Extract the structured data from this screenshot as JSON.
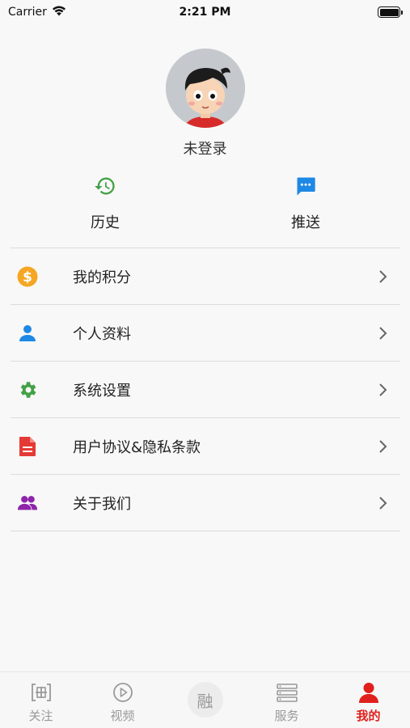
{
  "status_bar": {
    "carrier": "Carrier",
    "time": "2:21 PM"
  },
  "profile": {
    "login_status": "未登录"
  },
  "quick_actions": [
    {
      "label": "历史",
      "icon": "history-icon",
      "color": "#43a047"
    },
    {
      "label": "推送",
      "icon": "chat-bubble-icon",
      "color": "#1e88e5"
    }
  ],
  "menu": [
    {
      "label": "我的积分",
      "icon": "coin-icon",
      "color": "#f5a623"
    },
    {
      "label": "个人资料",
      "icon": "person-icon",
      "color": "#1e88e5"
    },
    {
      "label": "系统设置",
      "icon": "gear-icon",
      "color": "#43a047"
    },
    {
      "label": "用户协议&隐私条款",
      "icon": "document-icon",
      "color": "#e53935"
    },
    {
      "label": "关于我们",
      "icon": "group-icon",
      "color": "#8e24aa"
    }
  ],
  "tabbar": {
    "active_color": "#e0201c",
    "inactive_color": "#999999",
    "tabs": [
      {
        "label": "关注",
        "icon": "plus-frame-icon"
      },
      {
        "label": "视频",
        "icon": "play-circle-icon"
      },
      {
        "label": "融",
        "icon": "center-logo"
      },
      {
        "label": "服务",
        "icon": "list-icon"
      },
      {
        "label": "我的",
        "icon": "person-icon",
        "active": true
      }
    ]
  }
}
